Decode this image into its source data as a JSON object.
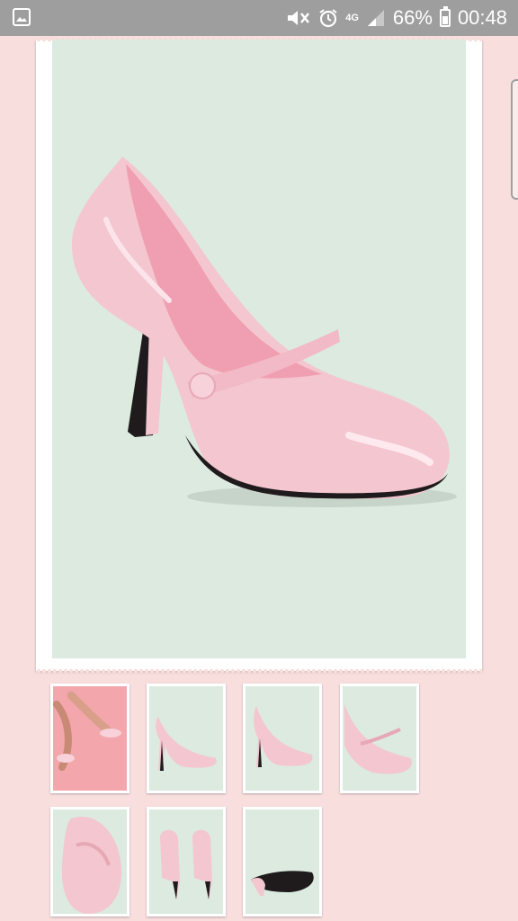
{
  "status_bar": {
    "network": "4G",
    "battery_percent": "66%",
    "battery_level": 0.66,
    "time": "00:48",
    "icons": [
      "gallery-icon",
      "mute-icon",
      "alarm-icon",
      "network-icon",
      "signal-icon",
      "battery-icon"
    ]
  },
  "colors": {
    "page_background": "#f8dfde",
    "status_bar": "#9e9e9e",
    "photo_background": "#dceae0",
    "shoe_pink": "#f4c6cf",
    "lining_pink": "#ef9fb1",
    "heel_black": "#1f1a1c",
    "pink_thumb_background": "#f3a6ac"
  },
  "gallery": {
    "main_image": "pink-mary-jane-pump",
    "thumbnails": [
      {
        "name": "legs-on-pink"
      },
      {
        "name": "side-view"
      },
      {
        "name": "side-view-2"
      },
      {
        "name": "closeup"
      },
      {
        "name": "top-view"
      },
      {
        "name": "back-view"
      },
      {
        "name": "sole-view"
      }
    ]
  }
}
